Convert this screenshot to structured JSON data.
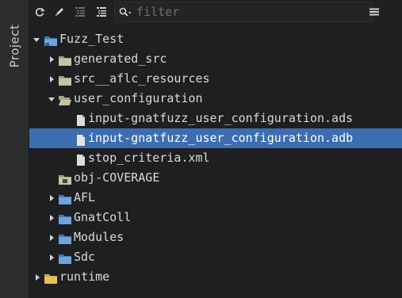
{
  "sidebar": {
    "tab_label": "Project"
  },
  "toolbar": {
    "buttons": [
      "reload-icon",
      "edit-icon",
      "collapse-all-icon",
      "expand-all-icon"
    ],
    "filter_placeholder": "filter",
    "filter_value": "",
    "menu": "hamburger-menu-icon"
  },
  "tree": {
    "root": "Fuzz_Test",
    "generated_src": "generated_src",
    "src_aflc": "src__aflc_resources",
    "user_config": "user_configuration",
    "ads_file": "input-gnatfuzz_user_configuration.ads",
    "adb_file": "input-gnatfuzz_user_configuration.adb",
    "stop_file": "stop_criteria.xml",
    "obj": "obj-COVERAGE",
    "afl": "AFL",
    "gnatcoll": "GnatColl",
    "modules": "Modules",
    "sdc": "Sdc",
    "runtime": "runtime"
  },
  "colors": {
    "background": "#1e1f20",
    "selection": "#3b6db0",
    "folder_plain": "#c8c2a6",
    "folder_project": "#6ea4da",
    "folder_runtime": "#e5c158"
  }
}
